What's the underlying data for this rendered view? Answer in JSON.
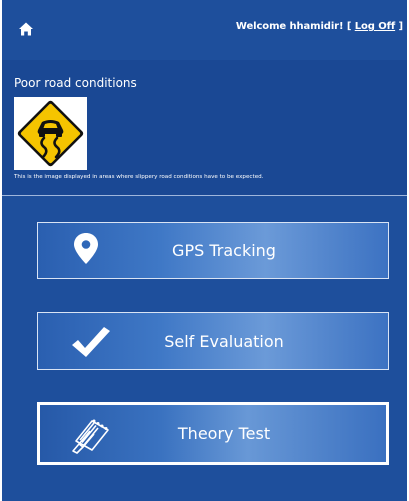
{
  "header": {
    "welcome_text": "Welcome hhamidir!",
    "bracket_open": "[",
    "logoff_label": "Log Off",
    "bracket_close": "]"
  },
  "info": {
    "title": "Poor road conditions",
    "caption": "This is the image displayed in areas where slippery road conditions have to be expected."
  },
  "menu": [
    {
      "label": "GPS Tracking",
      "icon": "location-pin-icon"
    },
    {
      "label": "Self Evaluation",
      "icon": "checkmark-icon"
    },
    {
      "label": "Theory Test",
      "icon": "notebook-pen-icon"
    }
  ],
  "colors": {
    "background": "#1e4f9c",
    "button_gradient_light": "#6b9ad8",
    "sign_yellow": "#f5c400",
    "text": "#ffffff"
  }
}
